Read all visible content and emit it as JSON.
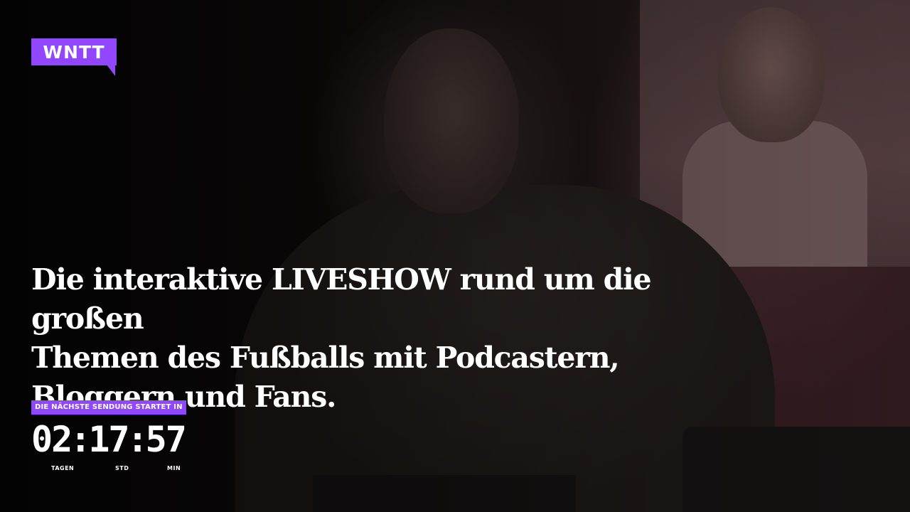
{
  "brand": {
    "logo_text": "WNTT",
    "accent_color": "#9146ff"
  },
  "hero": {
    "headline": "Die interaktive LIVESHOW rund um die großen\nThemen des Fußballs mit Podcastern,\nBloggern und Fans."
  },
  "countdown": {
    "label": "DIE NÄCHSTE SENDUNG STARTET IN",
    "days": "02",
    "hours": "17",
    "minutes": "57",
    "separator": ":",
    "unit_days": "TAGEN",
    "unit_hours": "STD",
    "unit_minutes": "MIN"
  }
}
